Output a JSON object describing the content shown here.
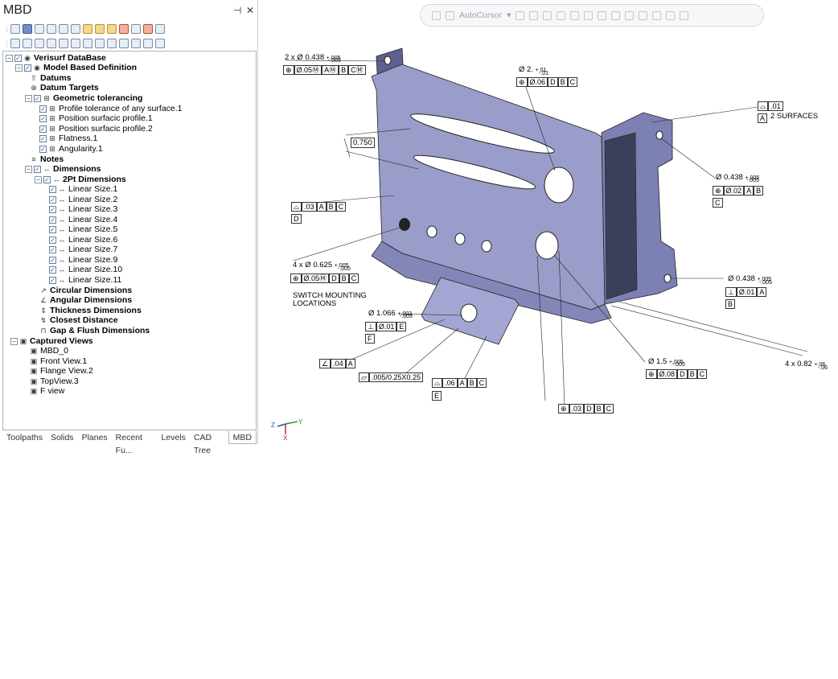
{
  "panel": {
    "title": "MBD",
    "pin_icon": "pin-icon",
    "close_icon": "close-icon"
  },
  "tree": [
    {
      "label": "Verisurf DataBase",
      "bold": true
    },
    {
      "label": "Model Based Definition",
      "bold": true
    },
    {
      "label": "Datums",
      "bold": true
    },
    {
      "label": "Datum Targets",
      "bold": true
    },
    {
      "label": "Geometric tolerancing",
      "bold": true
    },
    {
      "label": "Profile tolerance of any surface.1",
      "bold": false
    },
    {
      "label": "Position surfacic profile.1",
      "bold": false
    },
    {
      "label": "Position surfacic profile.2",
      "bold": false
    },
    {
      "label": "Flatness.1",
      "bold": false
    },
    {
      "label": "Angularity.1",
      "bold": false
    },
    {
      "label": "Notes",
      "bold": true
    },
    {
      "label": "Dimensions",
      "bold": true
    },
    {
      "label": "2Pt Dimensions",
      "bold": true
    },
    {
      "label": "Linear Size.1",
      "bold": false
    },
    {
      "label": "Linear Size.2",
      "bold": false
    },
    {
      "label": "Linear Size.3",
      "bold": false
    },
    {
      "label": "Linear Size.4",
      "bold": false
    },
    {
      "label": "Linear Size.5",
      "bold": false
    },
    {
      "label": "Linear Size.6",
      "bold": false
    },
    {
      "label": "Linear Size.7",
      "bold": false
    },
    {
      "label": "Linear Size.9",
      "bold": false
    },
    {
      "label": "Linear Size.10",
      "bold": false
    },
    {
      "label": "Linear Size.11",
      "bold": false
    },
    {
      "label": "Circular Dimensions",
      "bold": true
    },
    {
      "label": "Angular Dimensions",
      "bold": true
    },
    {
      "label": "Thickness Dimensions",
      "bold": true
    },
    {
      "label": "Closest Distance",
      "bold": true
    },
    {
      "label": "Gap & Flush Dimensions",
      "bold": true
    },
    {
      "label": "Captured Views",
      "bold": true
    },
    {
      "label": "MBD_0",
      "bold": false
    },
    {
      "label": "Front View.1",
      "bold": false
    },
    {
      "label": "Flange View.2",
      "bold": false
    },
    {
      "label": "TopView.3",
      "bold": false
    },
    {
      "label": "F view",
      "bold": false
    }
  ],
  "tabs": [
    "Toolpaths",
    "Solids",
    "Planes",
    "Recent Fu...",
    "Levels",
    "CAD Tree",
    "MBD"
  ],
  "toolbar": {
    "autocursor": "AutoCursor"
  },
  "annotations": {
    "dia_top_left": "2 x Ø 0.438",
    "tol_p005": "+.005",
    "tol_m005": "-.005",
    "fcf1": [
      "⊕",
      "Ø.05Ⓜ",
      "AⓂ",
      "B",
      "CⓂ"
    ],
    "dia_2": "Ø  2.",
    "tol_p01": "+.01",
    "tol_m01": "-.01",
    "fcf2": [
      "⊕",
      "Ø.06",
      "D",
      "B",
      "C"
    ],
    "dim_750": "0.750",
    "fcf_profile_d": [
      "⌓",
      ".03",
      "A",
      "B",
      "C"
    ],
    "datum_d": "D",
    "profile_01": [
      "⌓",
      ".01"
    ],
    "datum_a": "A",
    "two_surfaces": "2 SURFACES",
    "dia_438_c": "Ø  0.438",
    "fcf_c": [
      "⊕",
      "Ø.02",
      "A",
      "B"
    ],
    "datum_c": "C",
    "dia_625": "4 x Ø  0.625",
    "fcf_625": [
      "⊕",
      "Ø.05Ⓜ",
      "D",
      "B",
      "C"
    ],
    "switch_note": "SWITCH MOUNTING LOCATIONS",
    "dia_438_b": "Ø  0.438",
    "fcf_b": [
      "⊥",
      "Ø.01",
      "A"
    ],
    "datum_b": "B",
    "dia_1066": "Ø  1.066",
    "tol_p003": "+.003",
    "tol_m003": "-.003",
    "fcf_f": [
      "⊥",
      "Ø.01",
      "E"
    ],
    "datum_f": "F",
    "angularity": [
      "∠",
      ".04",
      "A"
    ],
    "flatness": [
      "▱",
      ".005/0.25X0.25"
    ],
    "fcf_e": [
      "⌓",
      ".06",
      "A",
      "B",
      "C"
    ],
    "datum_e": "E",
    "dia_15": "Ø  1.5",
    "fcf_15": [
      "⊕",
      "Ø.08",
      "D",
      "B",
      "C"
    ],
    "dim_082": "4 x  0.82",
    "tol_p06": "+.06",
    "tol_m06": "-.06",
    "fcf_bottom": [
      "⊕",
      ".03",
      "D",
      "B",
      "C"
    ]
  },
  "colors": {
    "part": "#9a9dc9",
    "part_dark": "#6c6f9e",
    "accent": "#2b5aa8"
  }
}
